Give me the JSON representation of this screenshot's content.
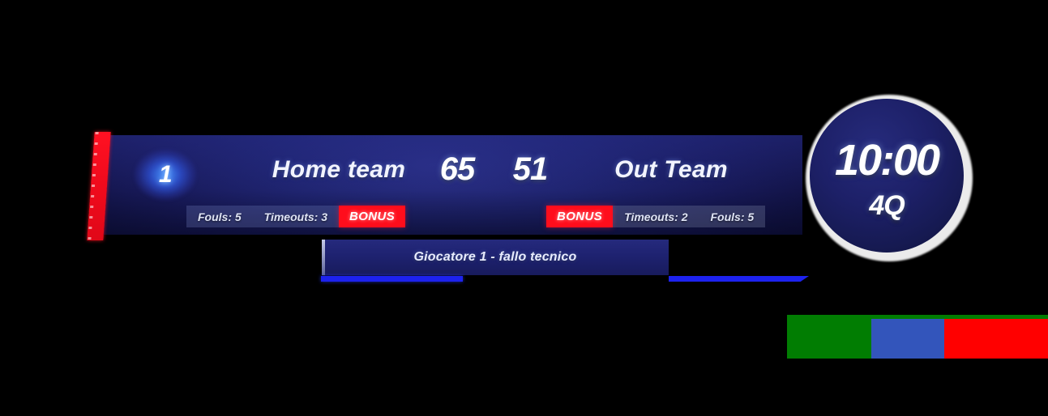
{
  "scoreboard": {
    "home": {
      "badge_number": "1",
      "name": "Home team",
      "score": "65",
      "fouls_label": "Fouls: 5",
      "timeouts_label": "Timeouts: 3",
      "bonus_label": "BONUS"
    },
    "away": {
      "name": "Out Team",
      "score": "51",
      "fouls_label": "Fouls: 5",
      "timeouts_label": "Timeouts: 2",
      "bonus_label": "BONUS"
    }
  },
  "clock": {
    "time": "10:00",
    "period": "4Q"
  },
  "ticker": {
    "message": "Giocatore 1 - fallo tecnico"
  },
  "colors": {
    "panel_navy": "#1f2470",
    "accent_red": "#ff0d1c",
    "accent_blue": "#1d22ee",
    "badge_glow_blue": "#4696ff",
    "swatch_green": "#017d02",
    "swatch_blue": "#3355bb",
    "swatch_red": "#ff0000",
    "text_white": "#ffffff"
  },
  "swatches": [
    {
      "name": "green-swatch",
      "hex": "#017d02"
    },
    {
      "name": "blue-swatch",
      "hex": "#3355bb"
    },
    {
      "name": "red-swatch",
      "hex": "#ff0000"
    }
  ]
}
